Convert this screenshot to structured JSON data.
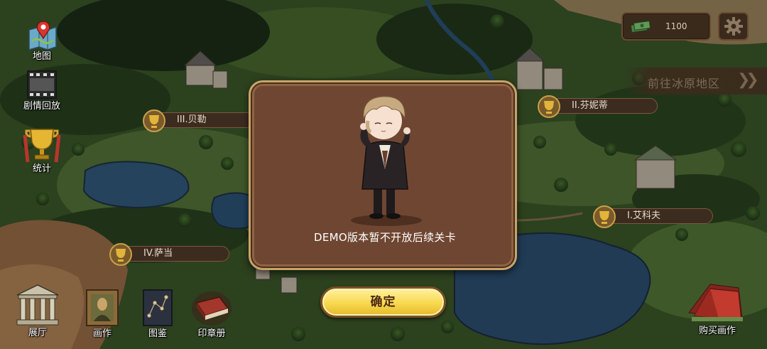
{
  "sidebar": {
    "map_label": "地图",
    "replay_label": "剧情回放",
    "stats_label": "统计"
  },
  "top_bar": {
    "currency_value": "1100",
    "currency_icon": "cash-icon",
    "settings_icon": "gear-icon"
  },
  "region_nav": {
    "label": "前往冰原地区",
    "icon": "double-chevron-right-icon"
  },
  "map_locations": [
    {
      "label": "III.贝勒"
    },
    {
      "label": "II.芬妮蒂"
    },
    {
      "label": "I.艾科夫"
    },
    {
      "label": "IV.萨当"
    }
  ],
  "dialog": {
    "message": "DEMO版本暂不开放后续关卡",
    "confirm_label": "确定"
  },
  "bottom_nav": {
    "hall_label": "展厅",
    "painting_label": "画作",
    "catalog_label": "图鉴",
    "stamp_label": "印章册",
    "buy_label": "购买画作"
  },
  "colors": {
    "dialog_bg": "#6f4631",
    "dialog_border": "#c8a46a",
    "button_yellow": "#f8d84f",
    "label_bg": "#3c2b1f"
  }
}
